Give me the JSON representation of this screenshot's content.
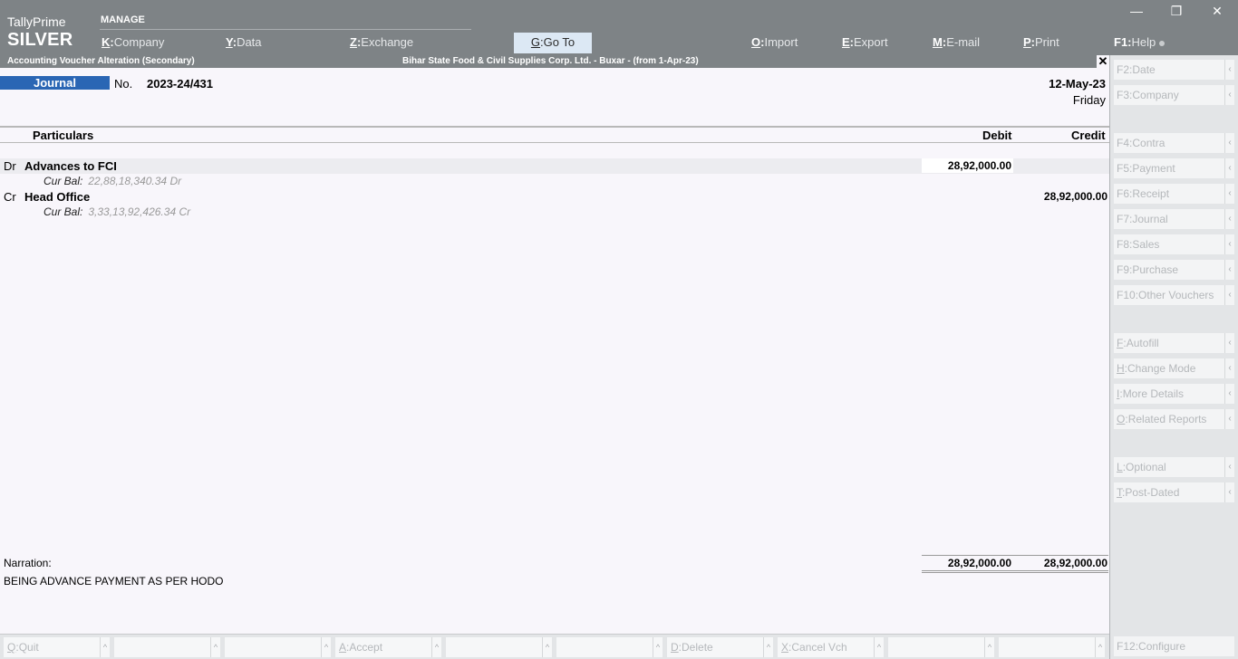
{
  "app": {
    "brand_line1": "TallyPrime",
    "brand_line2": "SILVER",
    "section": "MANAGE"
  },
  "topmenu": {
    "company": {
      "key": "K",
      "label": "Company"
    },
    "data": {
      "key": "Y",
      "label": "Data"
    },
    "exchange": {
      "key": "Z",
      "label": "Exchange"
    },
    "goto": {
      "key": "G",
      "label": "Go To"
    },
    "import": {
      "key": "O",
      "label": "Import"
    },
    "export": {
      "key": "E",
      "label": "Export"
    },
    "email": {
      "key": "M",
      "label": "E-mail"
    },
    "print": {
      "key": "P",
      "label": "Print"
    },
    "help": {
      "key": "F1",
      "label": "Help"
    }
  },
  "window": {
    "minimize": "—",
    "restore": "❐",
    "close": "✕",
    "panel_close": "✕"
  },
  "titlebar": {
    "screen": "Accounting Voucher Alteration (Secondary)",
    "company": "Bihar State Food & Civil Supplies Corp. Ltd. - Buxar - (from 1-Apr-23)"
  },
  "voucher": {
    "type": "Journal",
    "no_label": "No.",
    "number": "2023-24/431",
    "date": "12-May-23",
    "day": "Friday",
    "headers": {
      "particulars": "Particulars",
      "debit": "Debit",
      "credit": "Credit"
    },
    "entries": [
      {
        "drcr": "Dr",
        "ledger": "Advances to FCI",
        "debit": "28,92,000.00",
        "credit": "",
        "cur_bal_label": "Cur Bal:",
        "cur_bal": "22,88,18,340.34 Dr"
      },
      {
        "drcr": "Cr",
        "ledger": "Head Office",
        "debit": "",
        "credit": "28,92,000.00",
        "cur_bal_label": "Cur Bal:",
        "cur_bal": "3,33,13,92,426.34 Cr"
      }
    ],
    "narration_label": "Narration:",
    "narration": "BEING ADVANCE PAYMENT AS PER HODO",
    "total_debit": "28,92,000.00",
    "total_credit": "28,92,000.00"
  },
  "sidepanel": {
    "date": {
      "key": "F2",
      "label": "Date"
    },
    "company": {
      "key": "F3",
      "label": "Company"
    },
    "contra": {
      "key": "F4",
      "label": "Contra"
    },
    "payment": {
      "key": "F5",
      "label": "Payment"
    },
    "receipt": {
      "key": "F6",
      "label": "Receipt"
    },
    "journal": {
      "key": "F7",
      "label": "Journal"
    },
    "sales": {
      "key": "F8",
      "label": "Sales"
    },
    "purchase": {
      "key": "F9",
      "label": "Purchase"
    },
    "other": {
      "key": "F10",
      "label": "Other Vouchers"
    },
    "autofill": {
      "key": "F",
      "label": "Autofill"
    },
    "change_mode": {
      "key": "H",
      "label": "Change Mode"
    },
    "more_details": {
      "key": "I",
      "label": "More Details"
    },
    "related_reports": {
      "key": "O",
      "label": "Related Reports"
    },
    "optional": {
      "key": "L",
      "label": "Optional"
    },
    "post_dated": {
      "key": "T",
      "label": "Post-Dated"
    },
    "configure": {
      "key": "F12",
      "label": "Configure"
    },
    "chevron": "‹"
  },
  "bottombar": {
    "quit": {
      "key": "Q",
      "label": "Quit"
    },
    "accept": {
      "key": "A",
      "label": "Accept"
    },
    "delete": {
      "key": "D",
      "label": "Delete"
    },
    "cancel": {
      "key": "X",
      "label": "Cancel Vch"
    },
    "chevron": "^"
  }
}
